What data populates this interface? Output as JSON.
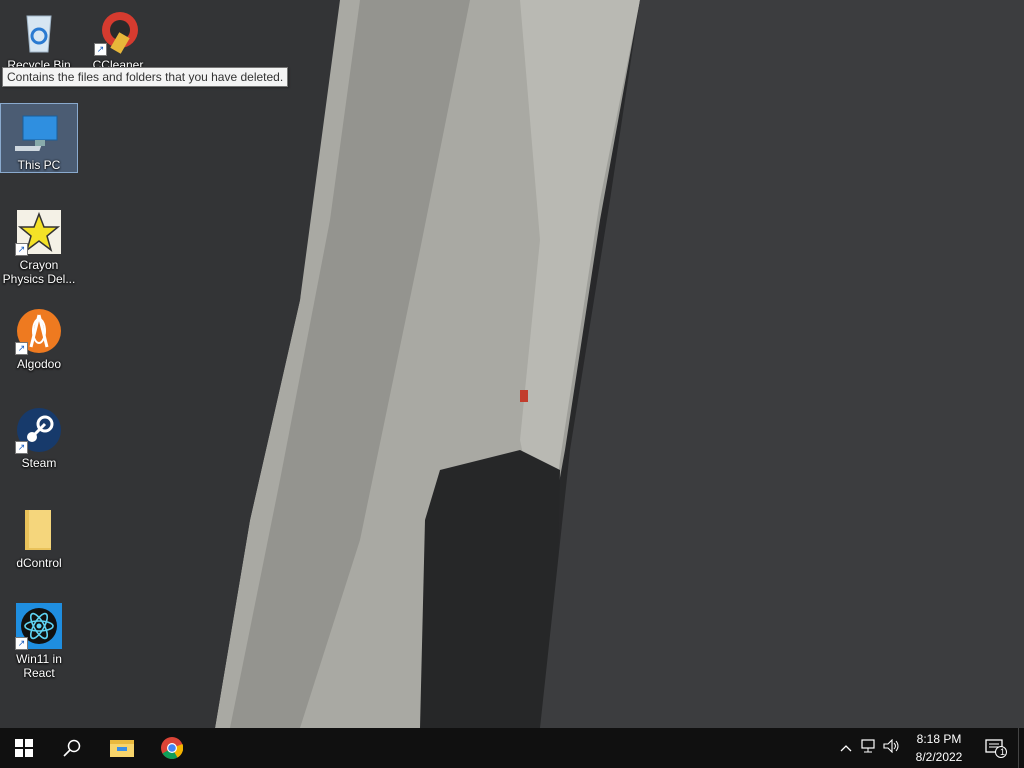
{
  "desktop": {
    "icons": [
      {
        "label": "Recycle Bin"
      },
      {
        "label": "CCleaner"
      },
      {
        "label": "This PC"
      },
      {
        "label": "Crayon Physics Del..."
      },
      {
        "label": "Algodoo"
      },
      {
        "label": "Steam"
      },
      {
        "label": "dControl"
      },
      {
        "label": "Win11 in React"
      }
    ],
    "tooltip": "Contains the files and folders that you have deleted."
  },
  "taskbar": {
    "clock_time": "8:18 PM",
    "clock_date": "8/2/2022",
    "notification_count": "1"
  },
  "colors": {
    "taskbar": "#101010",
    "accent": "#ffffff"
  }
}
